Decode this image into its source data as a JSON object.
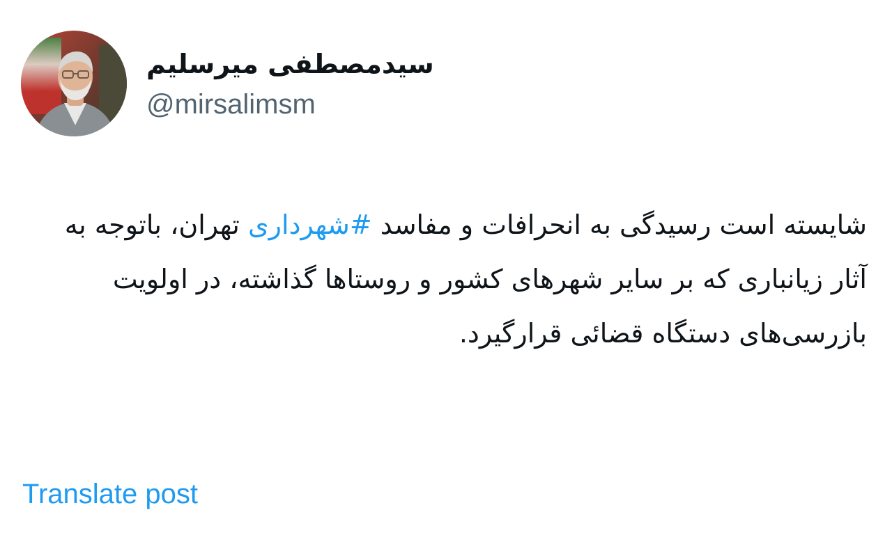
{
  "author": {
    "display_name": "سیدمصطفی میرسلیم",
    "handle": "@mirsalimsm",
    "avatar_icon": "profile-photo"
  },
  "post": {
    "text_before_hashtag": "شایسته است رسیدگی به انحرافات و مفاسد ",
    "hashtag": "#شهرداری",
    "text_after_hashtag": " تهران، باتوجه به آثار زیانباری که بر سایر شهرهای کشور و روستاها گذاشته، در اولویت بازرسی‌های دستگاه قضائی قرارگیرد."
  },
  "actions": {
    "translate_label": "Translate post"
  },
  "colors": {
    "link": "#1d9bf0",
    "text": "#0f1419",
    "secondary_text": "#536471",
    "background": "#ffffff"
  }
}
